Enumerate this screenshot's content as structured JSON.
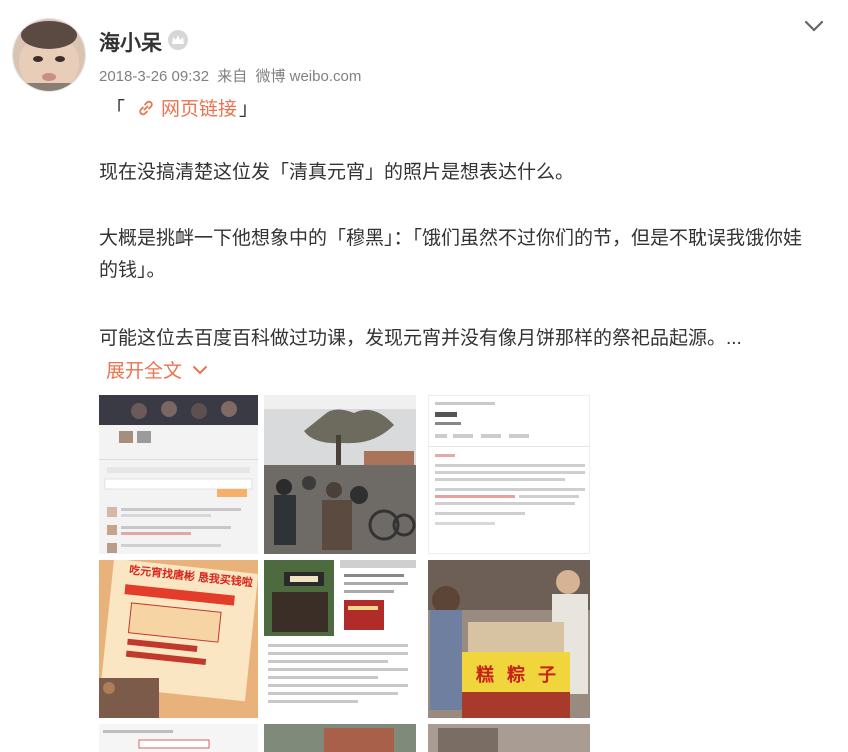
{
  "post": {
    "author": "海小呆",
    "timestamp": "2018-3-26 09:32",
    "source_prefix": "来自",
    "source": "微博 weibo.com",
    "bracket_open": "「",
    "bracket_close": "」",
    "link_label": "网页链接",
    "paragraphs": [
      "现在没搞清楚这位发「清真元宵」的照片是想表达什么。",
      "大概是挑衅一下他想象中的「穆黑」：「饿们虽然不过你们的节，但是不耽误我饿你娃的钱」。",
      "可能这位去百度百科做过功课，发现元宵并没有像月饼那样的祭祀品起源。..."
    ],
    "expand_label": "展开全文"
  },
  "images": {
    "poster_text": "吃元宵找唐彬 恳我买钱啦",
    "stall_sign": "糕 粽 子"
  },
  "colors": {
    "link": "#eb7350",
    "text": "#333333",
    "meta": "#808080"
  },
  "icons": {
    "crown": "crown-icon",
    "link": "link-icon",
    "chevron": "chevron-down-icon"
  }
}
